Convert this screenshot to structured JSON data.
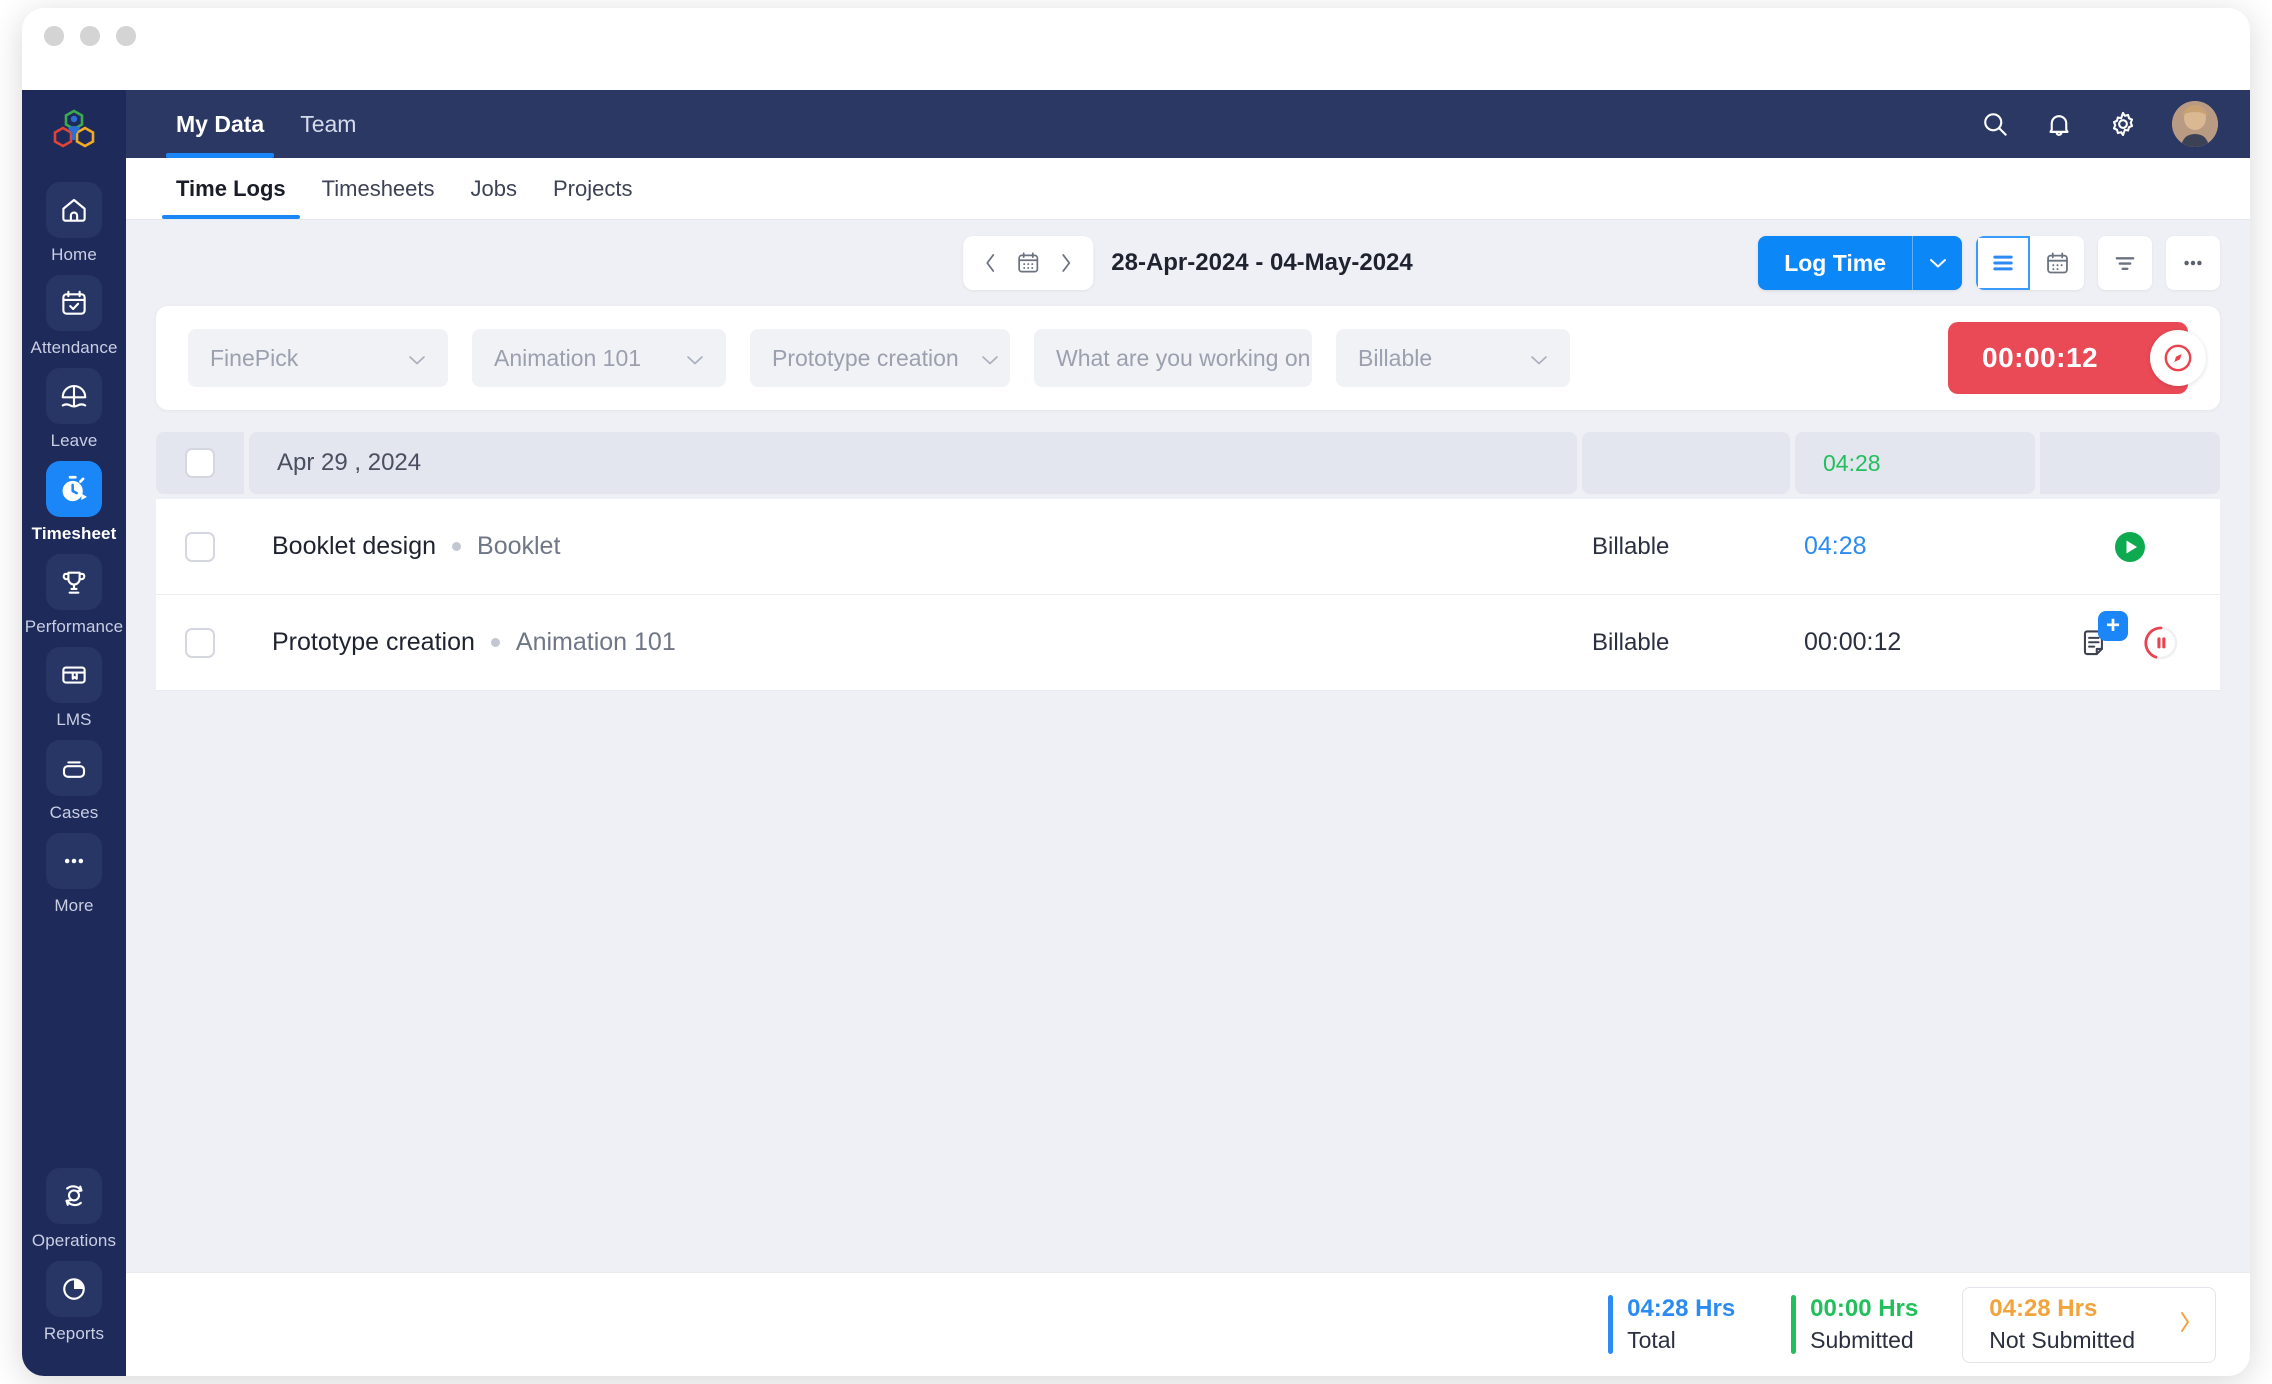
{
  "window": {
    "traffic_lights": [
      "close",
      "minimize",
      "maximize"
    ]
  },
  "sidebar": {
    "logo": "zoho-people-logo",
    "items": [
      {
        "label": "Home",
        "icon": "home-icon",
        "active": false
      },
      {
        "label": "Attendance",
        "icon": "calendar-check-icon",
        "active": false
      },
      {
        "label": "Leave",
        "icon": "beach-umbrella-icon",
        "active": false
      },
      {
        "label": "Timesheet",
        "icon": "timer-icon",
        "active": true
      },
      {
        "label": "Performance",
        "icon": "trophy-icon",
        "active": false
      },
      {
        "label": "LMS",
        "icon": "book-icon",
        "active": false
      },
      {
        "label": "Cases",
        "icon": "cases-icon",
        "active": false
      },
      {
        "label": "More",
        "icon": "ellipsis-icon",
        "active": false
      }
    ],
    "bottom_items": [
      {
        "label": "Operations",
        "icon": "operations-icon"
      },
      {
        "label": "Reports",
        "icon": "pie-chart-icon"
      }
    ]
  },
  "topbar": {
    "tabs": [
      {
        "label": "My Data",
        "active": true
      },
      {
        "label": "Team",
        "active": false
      }
    ],
    "icons": [
      "search-icon",
      "bell-icon",
      "gear-icon"
    ],
    "avatar": "user-avatar"
  },
  "subtabs": [
    {
      "label": "Time Logs",
      "active": true
    },
    {
      "label": "Timesheets",
      "active": false
    },
    {
      "label": "Jobs",
      "active": false
    },
    {
      "label": "Projects",
      "active": false
    }
  ],
  "toolbar": {
    "prev_icon": "chevron-left-icon",
    "calendar_icon": "calendar-icon",
    "next_icon": "chevron-right-icon",
    "date_range": "28-Apr-2024 - 04-May-2024",
    "log_time_label": "Log Time",
    "log_time_caret": "chevron-down-icon",
    "view_list_icon": "list-view-icon",
    "view_calendar_icon": "calendar-view-icon",
    "filter_icon": "filter-icon",
    "more_icon": "ellipsis-icon"
  },
  "filter_bar": {
    "project": "FinePick",
    "job": "Animation 101",
    "task": "Prototype creation",
    "note_placeholder": "What are you working on",
    "billable": "Billable",
    "timer_value": "00:00:12",
    "timer_icon": "stopwatch-icon"
  },
  "table": {
    "group": {
      "date": "Apr 29 , 2024",
      "total_duration": "04:28"
    },
    "rows": [
      {
        "task": "Booklet design",
        "job": "Booklet",
        "billable": "Billable",
        "duration": "04:28",
        "duration_color": "blue",
        "action": "play-icon"
      },
      {
        "task": "Prototype creation",
        "job": "Animation 101",
        "billable": "Billable",
        "duration": "00:00:12",
        "duration_color": "dark",
        "action": "pause-icon",
        "secondary_action": "add-note-icon",
        "badge": "+"
      }
    ]
  },
  "footer": {
    "total": {
      "value": "04:28 Hrs",
      "label": "Total",
      "color": "#2b8bf2"
    },
    "submitted": {
      "value": "00:00 Hrs",
      "label": "Submitted",
      "color": "#21c05c"
    },
    "not_submitted": {
      "value": "04:28 Hrs",
      "label": "Not Submitted",
      "color": "#f2a33c",
      "chevron": "chevron-right-icon"
    }
  },
  "colors": {
    "sidebar_bg": "#1e2a5a",
    "topbar_bg": "#2b3864",
    "accent_blue": "#0c87f7",
    "timer_red": "#ea4a56",
    "green": "#21c05c",
    "orange": "#f2a33c",
    "page_bg": "#eef0f5"
  }
}
